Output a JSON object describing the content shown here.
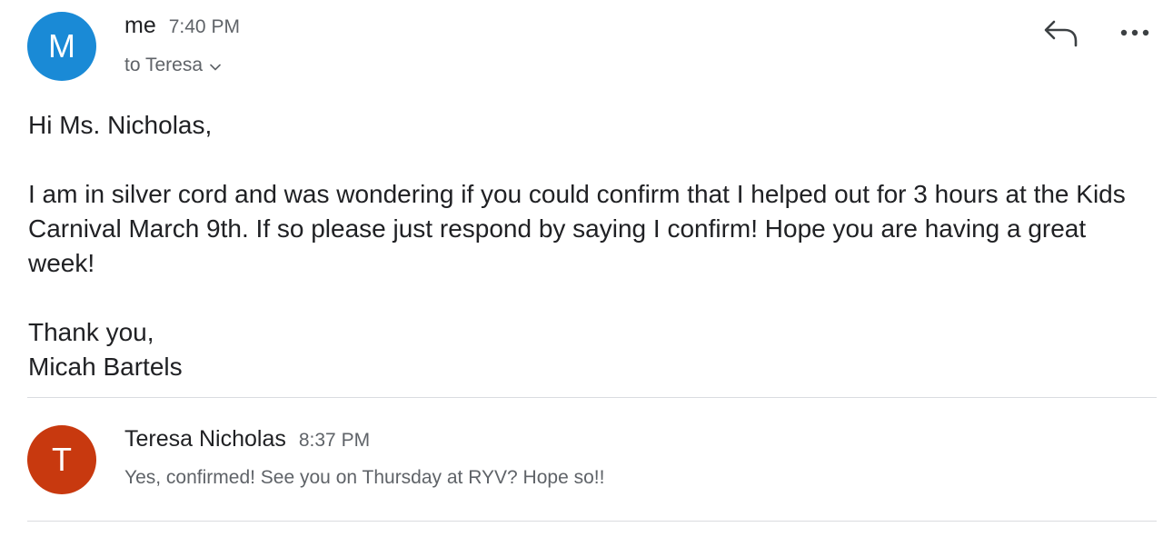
{
  "message1": {
    "avatar_letter": "M",
    "sender": "me",
    "time": "7:40 PM",
    "to_line": "to Teresa",
    "greeting": "Hi Ms. Nicholas,",
    "paragraph": "I am in silver cord and was wondering if you could confirm that I helped out for 3 hours at the Kids Carnival March 9th. If so please just respond by saying I confirm! Hope you are having a great week!",
    "signoff_line1": "Thank you,",
    "signoff_line2": "Micah Bartels",
    "avatar_color": "#1a8ad6"
  },
  "message2": {
    "avatar_letter": "T",
    "sender": "Teresa Nicholas",
    "time": "8:37 PM",
    "snippet": "Yes, confirmed! See you on Thursday at RYV? Hope so!!",
    "avatar_color": "#c8390f"
  },
  "icons": {
    "reply": "reply-icon",
    "more": "more-options-icon",
    "expand_recipients": "chevron-down-icon"
  }
}
